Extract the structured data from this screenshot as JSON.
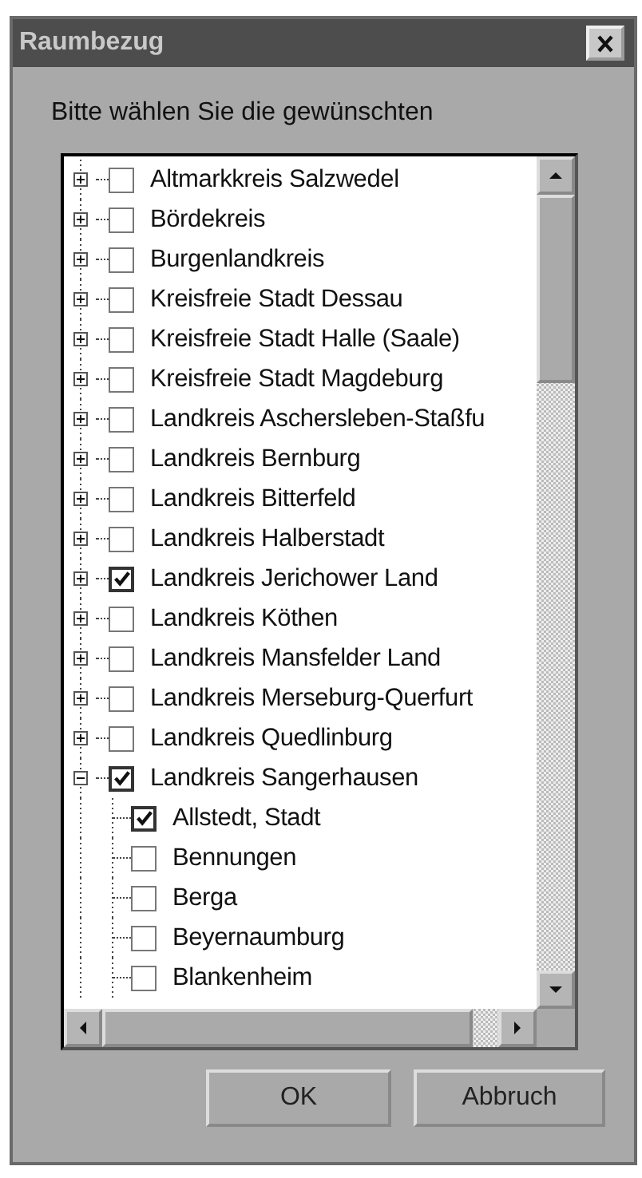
{
  "window": {
    "title": "Raumbezug"
  },
  "prompt": "Bitte wählen Sie die gewünschten",
  "tree": [
    {
      "label": "Altmarkkreis Salzwedel",
      "checked": false,
      "expanded": false
    },
    {
      "label": "Bördekreis",
      "checked": false,
      "expanded": false
    },
    {
      "label": "Burgenlandkreis",
      "checked": false,
      "expanded": false
    },
    {
      "label": "Kreisfreie Stadt Dessau",
      "checked": false,
      "expanded": false
    },
    {
      "label": "Kreisfreie Stadt Halle (Saale)",
      "checked": false,
      "expanded": false
    },
    {
      "label": "Kreisfreie Stadt Magdeburg",
      "checked": false,
      "expanded": false
    },
    {
      "label": "Landkreis Aschersleben-Staßfu",
      "checked": false,
      "expanded": false
    },
    {
      "label": "Landkreis Bernburg",
      "checked": false,
      "expanded": false
    },
    {
      "label": "Landkreis Bitterfeld",
      "checked": false,
      "expanded": false
    },
    {
      "label": "Landkreis Halberstadt",
      "checked": false,
      "expanded": false
    },
    {
      "label": "Landkreis Jerichower Land",
      "checked": true,
      "expanded": false
    },
    {
      "label": "Landkreis Köthen",
      "checked": false,
      "expanded": false
    },
    {
      "label": "Landkreis Mansfelder Land",
      "checked": false,
      "expanded": false
    },
    {
      "label": "Landkreis Merseburg-Querfurt",
      "checked": false,
      "expanded": false
    },
    {
      "label": "Landkreis Quedlinburg",
      "checked": false,
      "expanded": false
    },
    {
      "label": "Landkreis Sangerhausen",
      "checked": true,
      "expanded": true,
      "children": [
        {
          "label": "Allstedt, Stadt",
          "checked": true
        },
        {
          "label": "Bennungen",
          "checked": false
        },
        {
          "label": "Berga",
          "checked": false
        },
        {
          "label": "Beyernaumburg",
          "checked": false
        },
        {
          "label": "Blankenheim",
          "checked": false
        }
      ]
    }
  ],
  "buttons": [
    {
      "label": "OK"
    },
    {
      "label": "Abbruch"
    }
  ]
}
